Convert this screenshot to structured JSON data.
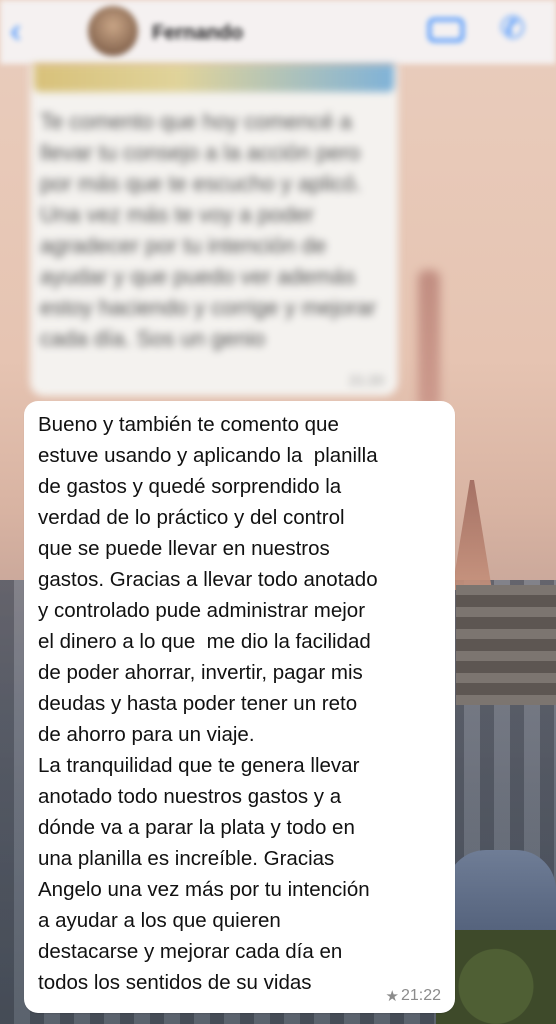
{
  "header": {
    "contact_name": "Fernando",
    "back_icon": "chevron-left-icon",
    "video_icon": "video-camera-icon",
    "phone_icon": "phone-icon"
  },
  "previous_message": {
    "text": "Te comento que hoy comencé a llevar tu consejo a la acción pero por más que te escucho y aplicó. Una vez más te voy a poder agradecer por tu intención de ayudar y que puedo ver además estoy haciendo y corrige y mejorar cada día. Sos un genio",
    "time": "21:20"
  },
  "message": {
    "text": "Bueno y también te comento que\nestuve usando y aplicando la  planilla\nde gastos y quedé sorprendido la\nverdad de lo práctico y del control\nque se puede llevar en nuestros\ngastos. Gracias a llevar todo anotado\ny controlado pude administrar mejor\nel dinero a lo que  me dio la facilidad\nde poder ahorrar, invertir, pagar mis\ndeudas y hasta poder tener un reto\nde ahorro para un viaje.\nLa tranquilidad que te genera llevar\nanotado todo nuestros gastos y a\ndónde va a parar la plata y todo en\nuna planilla es increíble. Gracias\nAngelo una vez más por tu intención\na ayudar a los que quieren\ndestacarse y mejorar cada día en\ntodos los sentidos de su vidas",
    "time": "21:22",
    "starred_icon": "star-icon"
  },
  "colors": {
    "accent": "#2c84ff",
    "bubble": "#ffffff",
    "meta_text": "#8b8b8b"
  }
}
